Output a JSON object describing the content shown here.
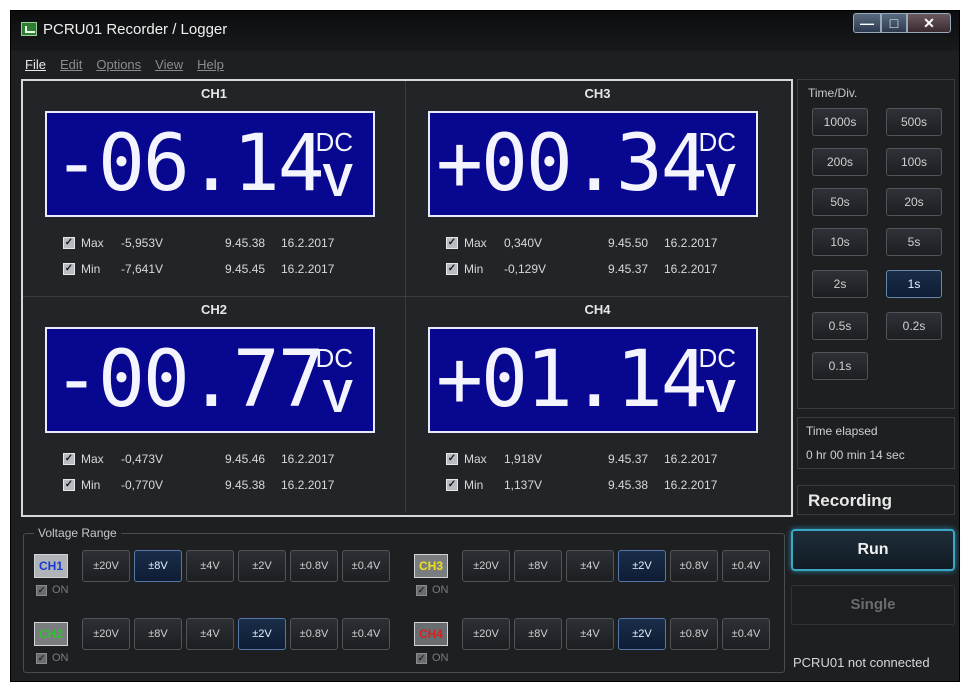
{
  "window": {
    "title": "PCRU01 Recorder / Logger"
  },
  "titlebar_buttons": {
    "minimize": "—",
    "maximize": "□",
    "close": "✕"
  },
  "menu": [
    {
      "label": "File",
      "enabled": true
    },
    {
      "label": "Edit",
      "enabled": false
    },
    {
      "label": "Options",
      "enabled": false
    },
    {
      "label": "View",
      "enabled": false
    },
    {
      "label": "Help",
      "enabled": false
    }
  ],
  "channels": {
    "ch1": {
      "name": "CH1",
      "reading": "-06.14",
      "mode": "DC",
      "unit": "V",
      "max": {
        "label": "Max",
        "value": "-5,953V",
        "time": "9.45.38",
        "date": "16.2.2017",
        "checked": true
      },
      "min": {
        "label": "Min",
        "value": "-7,641V",
        "time": "9.45.45",
        "date": "16.2.2017",
        "checked": true
      }
    },
    "ch3": {
      "name": "CH3",
      "reading": "+00.34",
      "mode": "DC",
      "unit": "V",
      "max": {
        "label": "Max",
        "value": "0,340V",
        "time": "9.45.50",
        "date": "16.2.2017",
        "checked": true
      },
      "min": {
        "label": "Min",
        "value": "-0,129V",
        "time": "9.45.37",
        "date": "16.2.2017",
        "checked": true
      }
    },
    "ch2": {
      "name": "CH2",
      "reading": "-00.77",
      "mode": "DC",
      "unit": "V",
      "max": {
        "label": "Max",
        "value": "-0,473V",
        "time": "9.45.46",
        "date": "16.2.2017",
        "checked": true
      },
      "min": {
        "label": "Min",
        "value": "-0,770V",
        "time": "9.45.38",
        "date": "16.2.2017",
        "checked": true
      }
    },
    "ch4": {
      "name": "CH4",
      "reading": "+01.14",
      "mode": "DC",
      "unit": "V",
      "max": {
        "label": "Max",
        "value": "1,918V",
        "time": "9.45.37",
        "date": "16.2.2017",
        "checked": true
      },
      "min": {
        "label": "Min",
        "value": "1,137V",
        "time": "9.45.38",
        "date": "16.2.2017",
        "checked": true
      }
    }
  },
  "time_div": {
    "label": "Time/Div.",
    "options": [
      "1000s",
      "500s",
      "200s",
      "100s",
      "50s",
      "20s",
      "10s",
      "5s",
      "2s",
      "1s",
      "0.5s",
      "0.2s",
      "0.1s"
    ],
    "selected": "1s"
  },
  "time_elapsed": {
    "label": "Time elapsed",
    "value": "0 hr  00 min  14 sec"
  },
  "recording_status": "Recording",
  "run_label": "Run",
  "single_label": "Single",
  "connection_status": "PCRU01 not connected",
  "voltage_range": {
    "label": "Voltage Range",
    "options": [
      "±20V",
      "±8V",
      "±4V",
      "±2V",
      "±0.8V",
      "±0.4V"
    ],
    "on_label": "ON",
    "channels": [
      {
        "name": "CH1",
        "color": "#1a3ad8",
        "selected": "±8V",
        "on": true
      },
      {
        "name": "CH3",
        "color": "#f0e020",
        "selected": "±2V",
        "on": true
      },
      {
        "name": "CH2",
        "color": "#30c030",
        "selected": "±2V",
        "on": true
      },
      {
        "name": "CH4",
        "color": "#d82020",
        "selected": "±2V",
        "on": true
      }
    ]
  },
  "colors": {
    "lcd_background": "#07078f",
    "window_background": "#1d1f21",
    "run_glow": "#3aa7c4"
  }
}
